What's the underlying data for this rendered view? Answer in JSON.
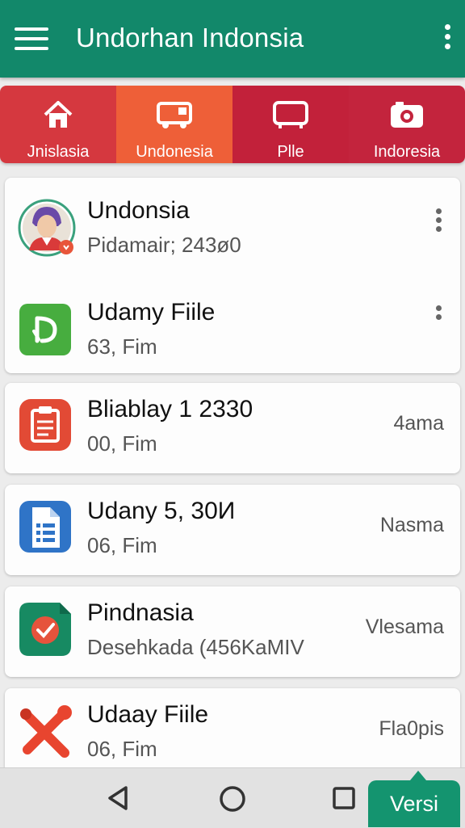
{
  "appbar": {
    "title": "Undorhan Indonsia",
    "menu_icon": "hamburger-icon",
    "overflow_icon": "more-vert-icon",
    "color": "#12886a"
  },
  "tabs": [
    {
      "label": "Jnislasia",
      "icon": "home-icon",
      "color": "#d5383f"
    },
    {
      "label": "Undonesia",
      "icon": "bus-icon",
      "color": "#ee5f38"
    },
    {
      "label": "Plle",
      "icon": "tv-icon",
      "color": "#c2213a"
    },
    {
      "label": "Indoresia",
      "icon": "camera-icon",
      "color": "#c3243d"
    }
  ],
  "items": [
    {
      "title": "Undonsia",
      "subtitle": "Pidamair; 243ø0",
      "icon": "avatar-icon"
    },
    {
      "title": "Udamy Fiile",
      "subtitle": "63, Fim",
      "icon": "music-note-icon"
    },
    {
      "title": "Bliablay 1 2330",
      "subtitle": "00, Fim",
      "meta": "4ama",
      "icon": "clipboard-icon"
    },
    {
      "title": "Udany 5, 30И",
      "subtitle": "06, Fim",
      "meta": "Nasma",
      "icon": "document-icon"
    },
    {
      "title": "Pindnasia",
      "subtitle": "Desehkada (456KaMIV",
      "meta": "Vlesama",
      "icon": "checkmark-file-icon"
    },
    {
      "title": "Udaay Fiile",
      "subtitle": "06, Fim",
      "meta": "Fla0pis",
      "icon": "tools-icon"
    }
  ],
  "navbar": {
    "back_icon": "back-triangle-icon",
    "home_icon": "home-circle-icon",
    "recents_icon": "recents-square-icon",
    "action_label": "Versi"
  }
}
